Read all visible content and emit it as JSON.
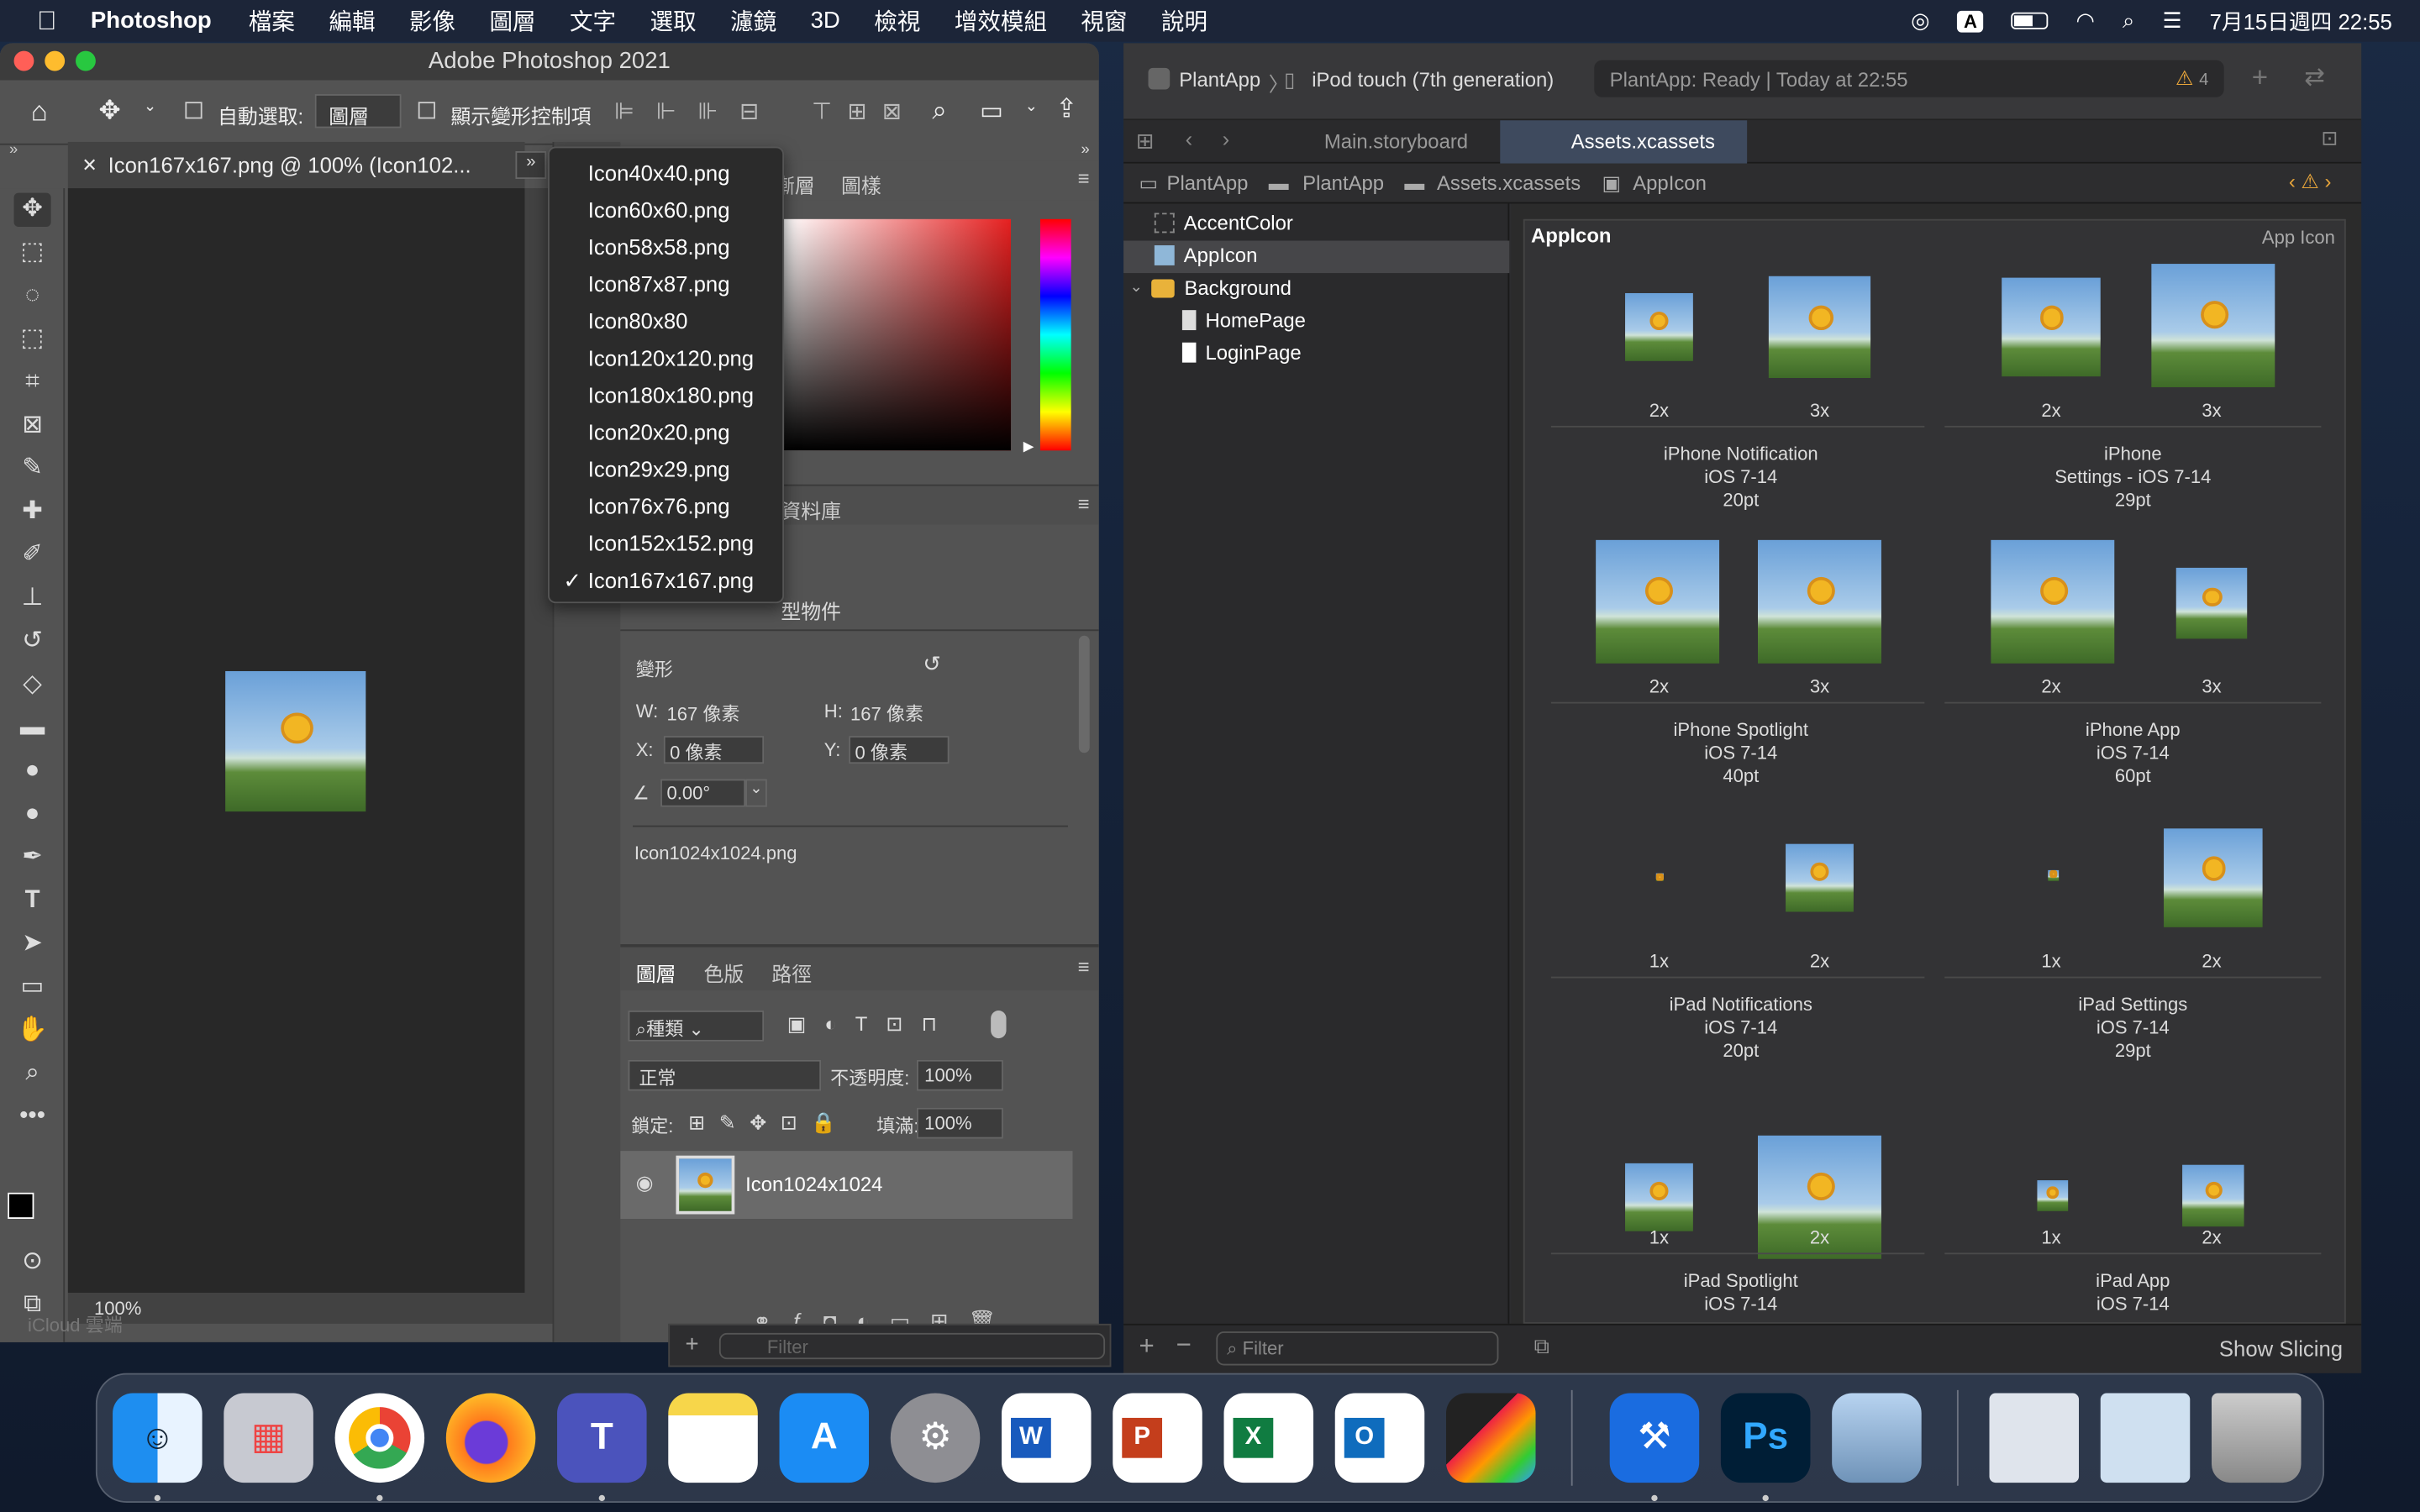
{
  "menubar": {
    "apple": "",
    "app": "Photoshop",
    "items": [
      "檔案",
      "編輯",
      "影像",
      "圖層",
      "文字",
      "選取",
      "濾鏡",
      "3D",
      "檢視",
      "增效模組",
      "視窗",
      "說明"
    ],
    "input_method": "A",
    "datetime": "7月15日週四 22:55"
  },
  "photoshop": {
    "title": "Adobe Photoshop 2021",
    "options": {
      "auto_select_label": "自動選取:",
      "auto_select_value": "圖層",
      "transform_label": "顯示變形控制項"
    },
    "doc_tab": "Icon167x167.png @ 100% (Icon102...",
    "zoom": "100%",
    "behind_text": "iCloud 雲端",
    "panel_tabs": [
      "漸層",
      "圖樣"
    ],
    "lib_tab": "資料庫",
    "props_title": "型物件",
    "transform": {
      "label": "變形",
      "w_label": "W:",
      "w": "167 像素",
      "h_label": "H:",
      "h": "167 像素",
      "x_label": "X:",
      "x": "0 像素",
      "y_label": "Y:",
      "y": "0 像素",
      "angle": "0.00°"
    },
    "linked_file": "Icon1024x1024.png",
    "layers_tabs": [
      "圖層",
      "色版",
      "路徑"
    ],
    "filter_kind": "種類",
    "blend_mode": "正常",
    "opacity_label": "不透明度:",
    "opacity": "100%",
    "lock_label": "鎖定:",
    "fill_label": "填滿:",
    "fill": "100%",
    "layer_name": "Icon1024x1024",
    "filter_placeholder": "Filter"
  },
  "tab_dropdown": {
    "items": [
      "Icon40x40.png",
      "Icon60x60.png",
      "Icon58x58.png",
      "Icon87x87.png",
      "Icon80x80",
      "Icon120x120.png",
      "Icon180x180.png",
      "Icon20x20.png",
      "Icon29x29.png",
      "Icon76x76.png",
      "Icon152x152.png",
      "Icon167x167.png"
    ],
    "checked": "✓"
  },
  "xcode": {
    "scheme": "PlantApp",
    "device": "iPod touch (7th generation)",
    "status": "PlantApp: Ready | Today at 22:55",
    "warnings": "4",
    "tabs": [
      "Main.storyboard",
      "Assets.xcassets"
    ],
    "jump": [
      "PlantApp",
      "PlantApp",
      "Assets.xcassets",
      "AppIcon"
    ],
    "nav": {
      "accent": "AccentColor",
      "appicon": "AppIcon",
      "background": "Background",
      "home": "HomePage",
      "login": "LoginPage"
    },
    "editor_title": "AppIcon",
    "editor_kind": "App Icon",
    "groups": [
      {
        "scales": [
          "2x",
          "3x"
        ],
        "caption": [
          "iPhone Notification",
          "iOS 7-14",
          "20pt"
        ]
      },
      {
        "scales": [
          "2x",
          "3x"
        ],
        "caption": [
          "iPhone",
          "Settings - iOS 7-14",
          "29pt"
        ]
      },
      {
        "scales": [
          "2x",
          "3x"
        ],
        "caption": [
          "iPhone Spotlight",
          "iOS 7-14",
          "40pt"
        ]
      },
      {
        "scales": [
          "2x",
          "3x"
        ],
        "caption": [
          "iPhone App",
          "iOS 7-14",
          "60pt"
        ]
      },
      {
        "scales": [
          "1x",
          "2x"
        ],
        "caption": [
          "iPad Notifications",
          "iOS 7-14",
          "20pt"
        ]
      },
      {
        "scales": [
          "1x",
          "2x"
        ],
        "caption": [
          "iPad Settings",
          "iOS 7-14",
          "29pt"
        ]
      },
      {
        "scales": [
          "1x",
          "2x"
        ],
        "caption": [
          "iPad Spotlight",
          "iOS 7-14"
        ]
      },
      {
        "scales": [
          "1x",
          "2x"
        ],
        "caption": [
          "iPad App",
          "iOS 7-14"
        ]
      }
    ],
    "filter": "Filter",
    "show_slicing": "Show Slicing"
  },
  "dock": [
    "Finder",
    "Launchpad",
    "Chrome",
    "Firefox",
    "Teams",
    "Notes",
    "App Store",
    "System Preferences",
    "Word",
    "PowerPoint",
    "Excel",
    "Outlook",
    "Final Cut Pro",
    "Xcode",
    "Photoshop",
    "Preview",
    "Window 1",
    "Window 2",
    "Trash"
  ]
}
